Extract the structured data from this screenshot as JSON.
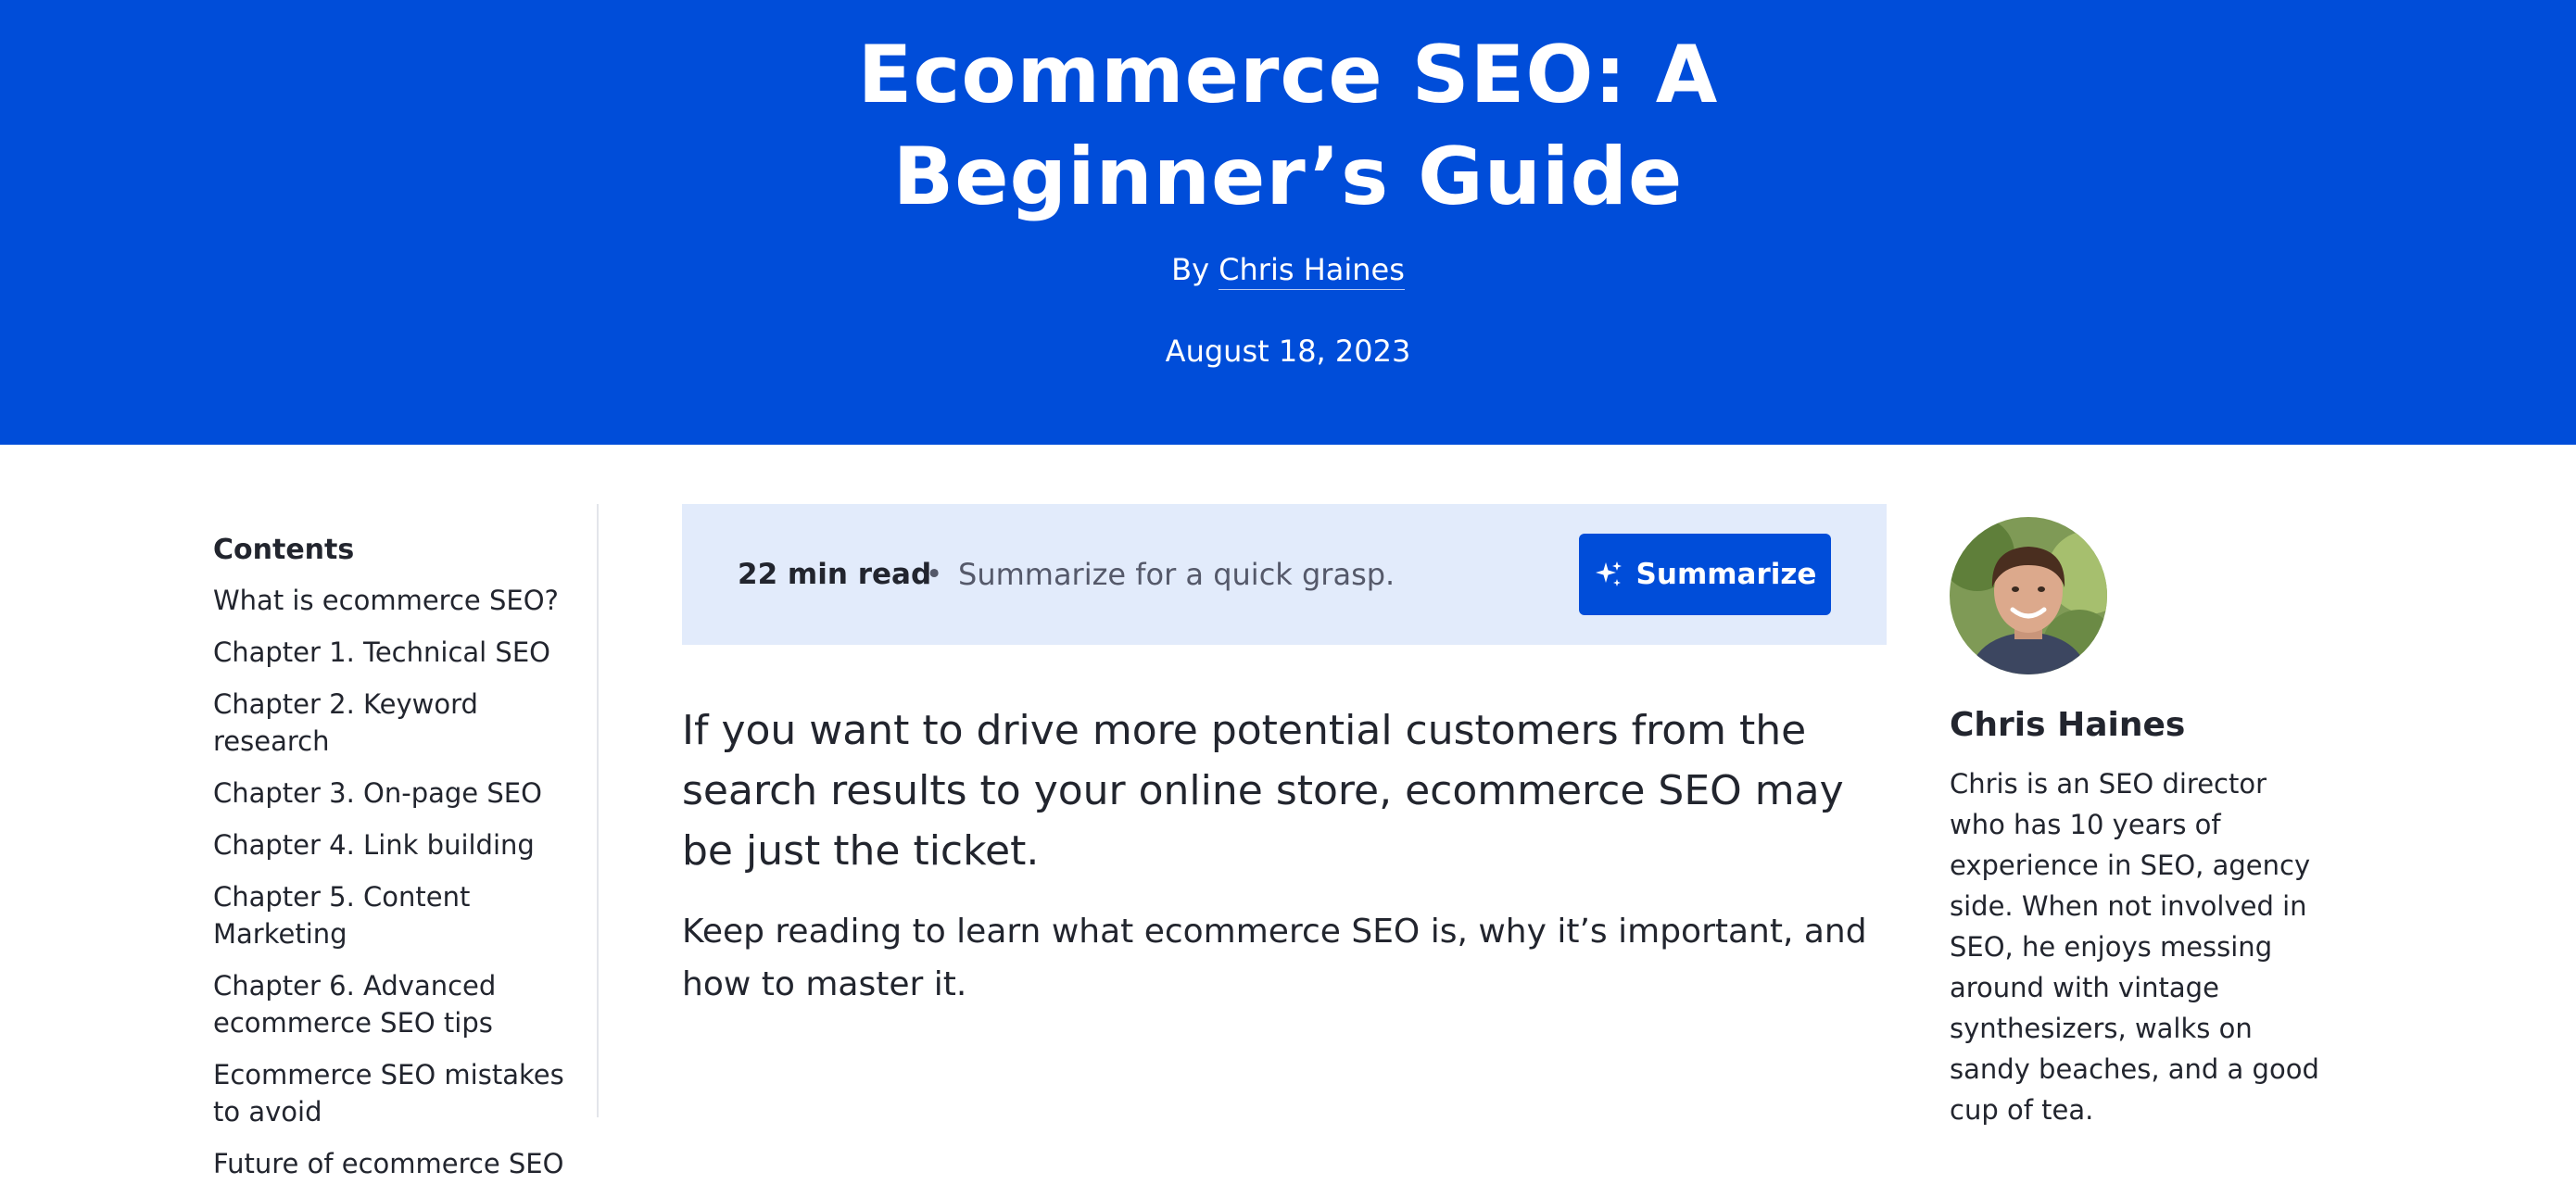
{
  "hero": {
    "title": "Ecommerce SEO: A Beginner’s Guide",
    "by_label": "By",
    "author_link": "Chris Haines",
    "date": "August 18, 2023"
  },
  "toc": {
    "title": "Contents",
    "items": [
      "What is ecommerce SEO?",
      "Chapter 1. Technical SEO",
      "Chapter 2. Keyword research",
      "Chapter 3. On-page SEO",
      "Chapter 4. Link building",
      "Chapter 5. Content Marketing",
      "Chapter 6. Advanced ecommerce SEO tips",
      "Ecommerce SEO mistakes to avoid",
      "Future of ecommerce SEO"
    ]
  },
  "summary": {
    "read_time": "22 min read",
    "separator": "•",
    "text": "Summarize for a quick grasp.",
    "button_label": "Summarize",
    "icon": "sparkle-icon"
  },
  "article": {
    "lede": "If you want to drive more potential customers from the search results to your online store, ecommerce SEO may be just the ticket.",
    "para": "Keep reading to learn what ecommerce SEO is, why it’s important, and how to master it."
  },
  "author": {
    "name": "Chris Haines",
    "bio": "Chris is an SEO director who has 10 years of experience in SEO, agency side. When not involved in SEO, he enjoys messing around with vintage synthesizers, walks on sandy beaches, and a good cup of tea."
  },
  "colors": {
    "brand": "#004dd9",
    "summary_bg": "#e2ebfb",
    "text": "#22252e"
  }
}
